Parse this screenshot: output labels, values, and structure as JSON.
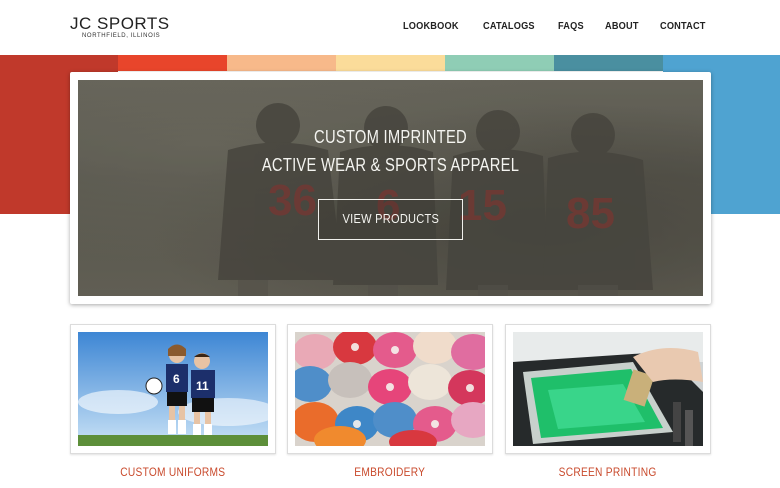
{
  "header": {
    "logo_main_a": "JC",
    "logo_main_b": "SPORTS",
    "logo_sub": "NORTHFIELD, ILLINOIS",
    "nav": [
      "LOOKBOOK",
      "CATALOGS",
      "FAQS",
      "ABOUT",
      "CONTACT"
    ]
  },
  "band_colors": [
    "#c0392b",
    "#e8452b",
    "#f7b98a",
    "#fbdc9a",
    "#8fcdb5",
    "#4a8fa0",
    "#4fa3d1"
  ],
  "hero": {
    "line1": "CUSTOM IMPRINTED",
    "line2": "ACTIVE WEAR & SPORTS APPAREL",
    "button": "VIEW PRODUCTS",
    "jersey_numbers": [
      "36",
      "6",
      "15",
      "85"
    ]
  },
  "cards": [
    {
      "label": "CUSTOM UNIFORMS",
      "jersey_numbers": [
        "6",
        "11"
      ]
    },
    {
      "label": "EMBROIDERY"
    },
    {
      "label": "SCREEN PRINTING"
    }
  ],
  "accent_color": "#c94a2c"
}
